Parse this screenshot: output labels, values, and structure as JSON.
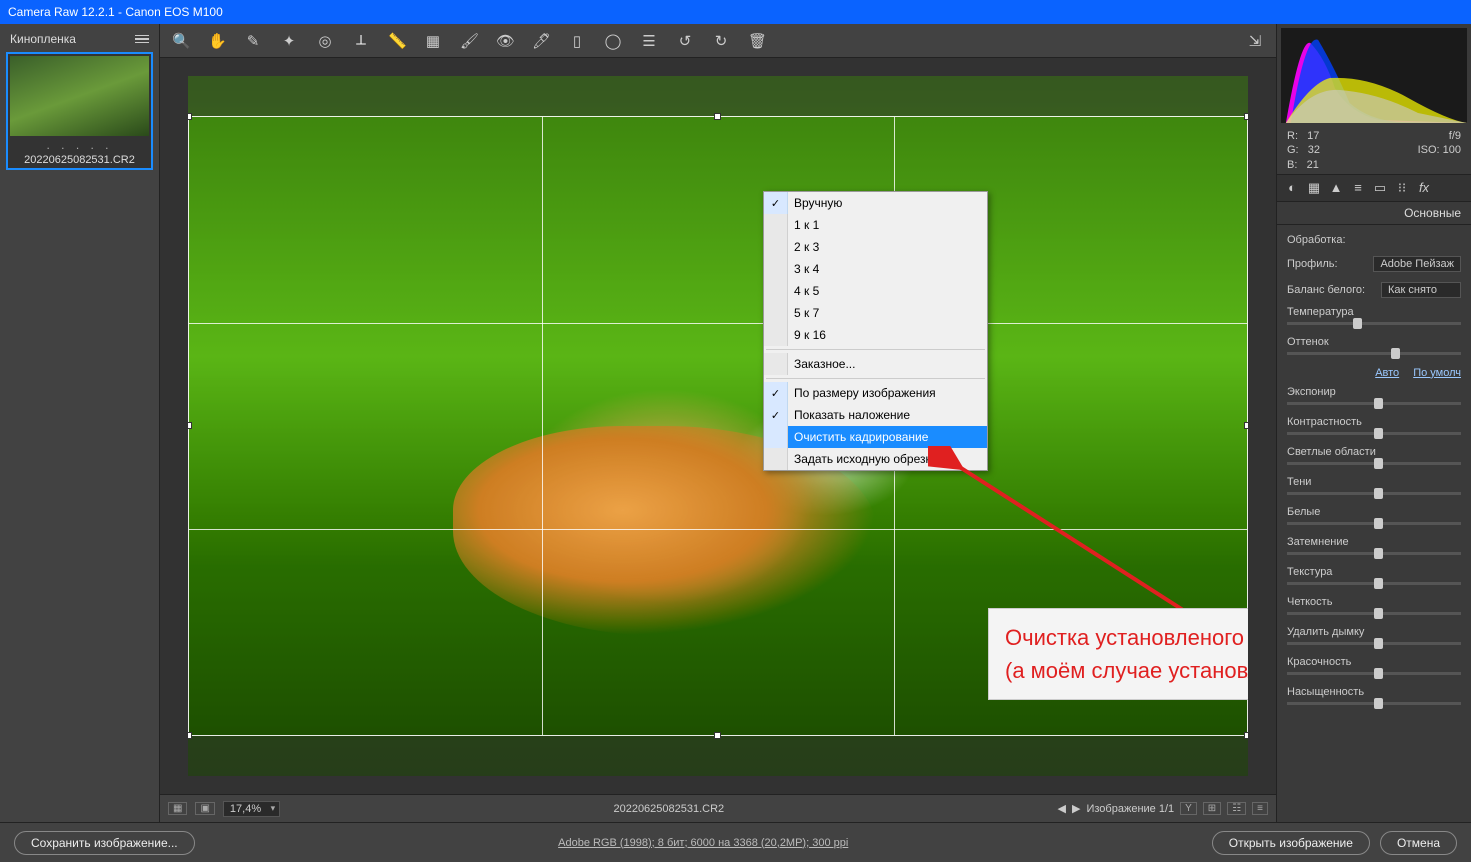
{
  "title": "Camera Raw 12.2.1  -  Canon EOS M100",
  "filmstrip": {
    "header": "Кинопленка",
    "filename": "20220625082531.CR2"
  },
  "context_menu": {
    "items": [
      {
        "label": "Вручную",
        "checked": true
      },
      {
        "label": "1 к 1"
      },
      {
        "label": "2 к 3"
      },
      {
        "label": "3 к 4"
      },
      {
        "label": "4 к 5"
      },
      {
        "label": "5 к 7"
      },
      {
        "label": "9 к 16"
      },
      {
        "label": "Заказное..."
      }
    ],
    "group2": [
      {
        "label": "По размеру изображения",
        "checked": true
      },
      {
        "label": "Показать наложение",
        "checked": true
      },
      {
        "label": "Очистить кадрирование",
        "highlighted": true
      },
      {
        "label": "Задать исходную обрезку"
      }
    ]
  },
  "callout": {
    "line1": "Очистка установленого кадрирования",
    "line2": "(а моём случае установленого камерой)"
  },
  "bottombar": {
    "zoom": "17,4%",
    "filename": "20220625082531.CR2",
    "nav": "Изображение 1/1",
    "mark": "Y"
  },
  "rgb": {
    "r_label": "R:",
    "r": "17",
    "g_label": "G:",
    "g": "32",
    "b_label": "B:",
    "b": "21",
    "f": "f/9",
    "iso": "ISO: 100"
  },
  "panel": {
    "title": "Основные",
    "treatment_label": "Обработка:",
    "profile_label": "Профиль:",
    "profile_value": "Adobe Пейзаж",
    "wb_label": "Баланс белого:",
    "wb_value": "Как снято",
    "temp": "Температура",
    "tint": "Оттенок",
    "auto": "Авто",
    "default": "По умолч",
    "sliders": [
      "Экспонир",
      "Контрастность",
      "Светлые области",
      "Тени",
      "Белые",
      "Затемнение",
      "Текстура",
      "Четкость",
      "Удалить дымку",
      "Красочность",
      "Насыщенность"
    ]
  },
  "footer": {
    "save": "Сохранить изображение...",
    "info": "Adobe RGB (1998); 8 бит; 6000 на 3368 (20,2МР); 300 ppi",
    "open": "Открыть изображение",
    "cancel": "Отмена"
  }
}
